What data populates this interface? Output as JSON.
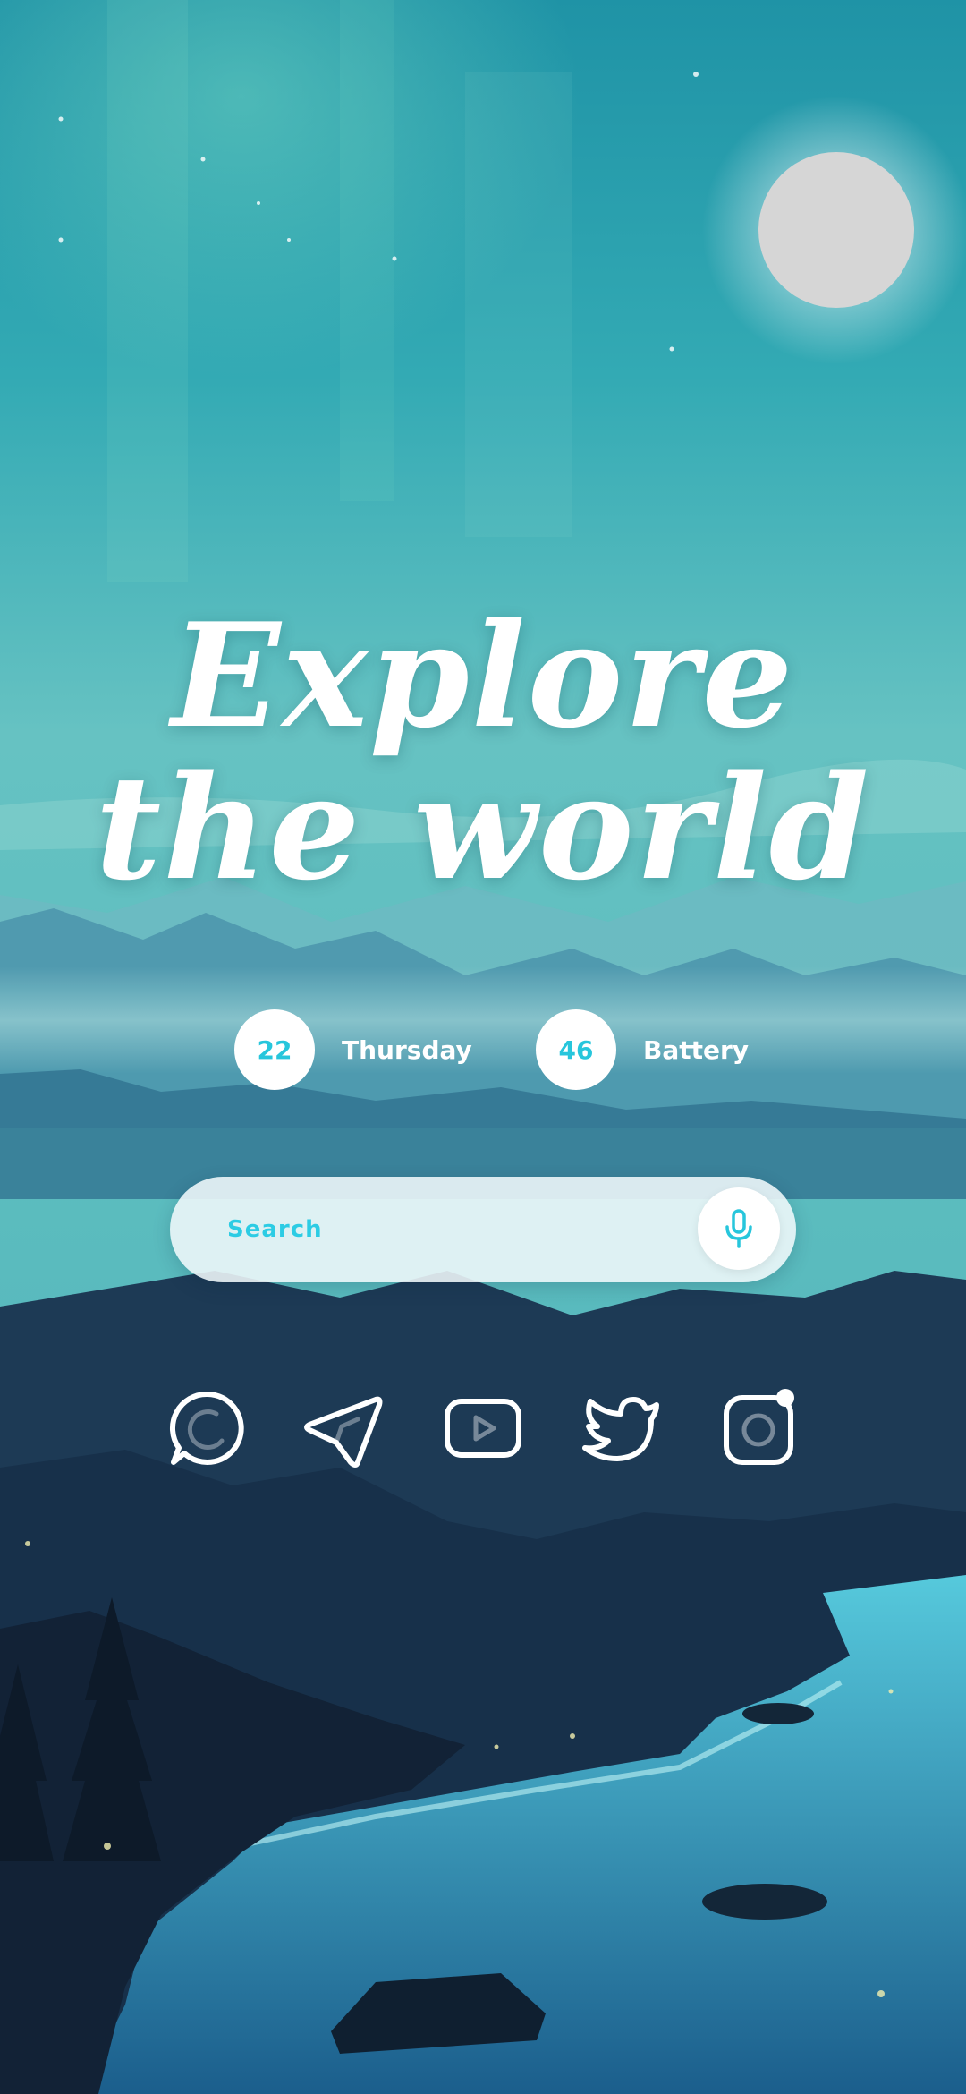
{
  "hero": {
    "line1": "Explore",
    "line2": "the world"
  },
  "widgets": {
    "date": {
      "value": "22",
      "label": "Thursday"
    },
    "battery": {
      "value": "46",
      "label": "Battery"
    }
  },
  "search": {
    "placeholder": "Search",
    "mic_icon": "microphone-icon"
  },
  "dock": {
    "apps": [
      {
        "name": "WhatsApp",
        "icon": "whatsapp-icon"
      },
      {
        "name": "Telegram",
        "icon": "telegram-icon"
      },
      {
        "name": "YouTube",
        "icon": "youtube-icon"
      },
      {
        "name": "Twitter",
        "icon": "twitter-icon"
      },
      {
        "name": "Instagram",
        "icon": "instagram-icon",
        "notification": true
      }
    ]
  },
  "colors": {
    "accent": "#27c6dc",
    "icon_stroke": "#ffffff",
    "sky_top": "#1e93a8",
    "sky_mid": "#5cc2c2",
    "moon": "#d6d6d6",
    "mountains_dark": "#172a40",
    "water": "#3fb6d0"
  }
}
